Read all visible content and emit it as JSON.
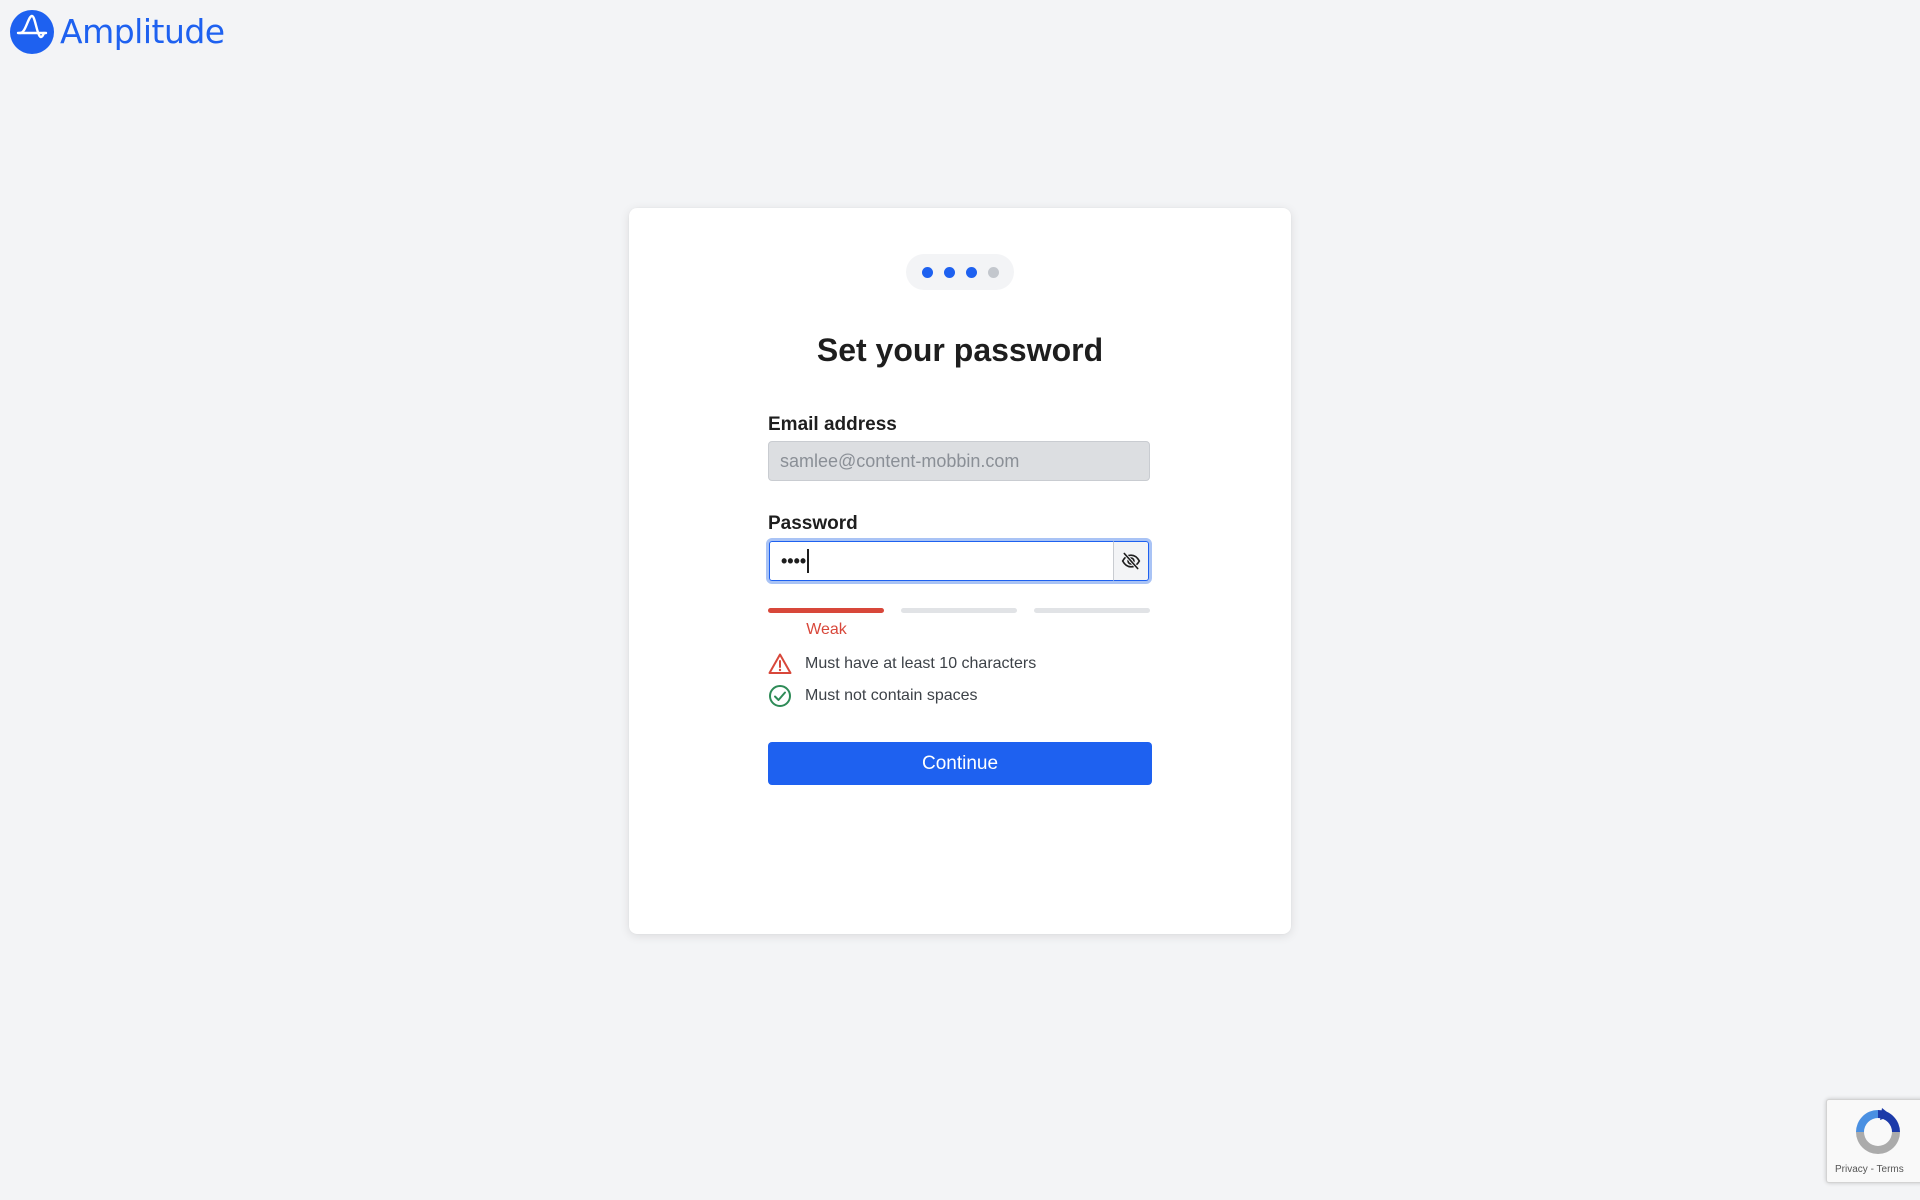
{
  "brand": {
    "name": "Amplitude",
    "color": "#1e61f0"
  },
  "stepper": {
    "total_steps": 4,
    "current_step": 3
  },
  "form": {
    "title": "Set your password",
    "email": {
      "label": "Email address",
      "placeholder": "samlee@content-mobbin.com",
      "disabled": true
    },
    "password": {
      "label": "Password",
      "masked_value": "••••",
      "toggle_icon": "eye-off-icon"
    },
    "strength": {
      "label": "Weak",
      "level": 1,
      "max_level": 3,
      "color": "#d8473a"
    },
    "rules": [
      {
        "text": "Must have at least 10 characters",
        "status": "warning",
        "icon": "warning-triangle-icon",
        "color": "#d8473a"
      },
      {
        "text": "Must not contain spaces",
        "status": "passed",
        "icon": "check-circle-icon",
        "color": "#2e8b57"
      }
    ],
    "submit_label": "Continue"
  },
  "recaptcha": {
    "privacy_label": "Privacy",
    "separator": "-",
    "terms_label": "Terms"
  }
}
